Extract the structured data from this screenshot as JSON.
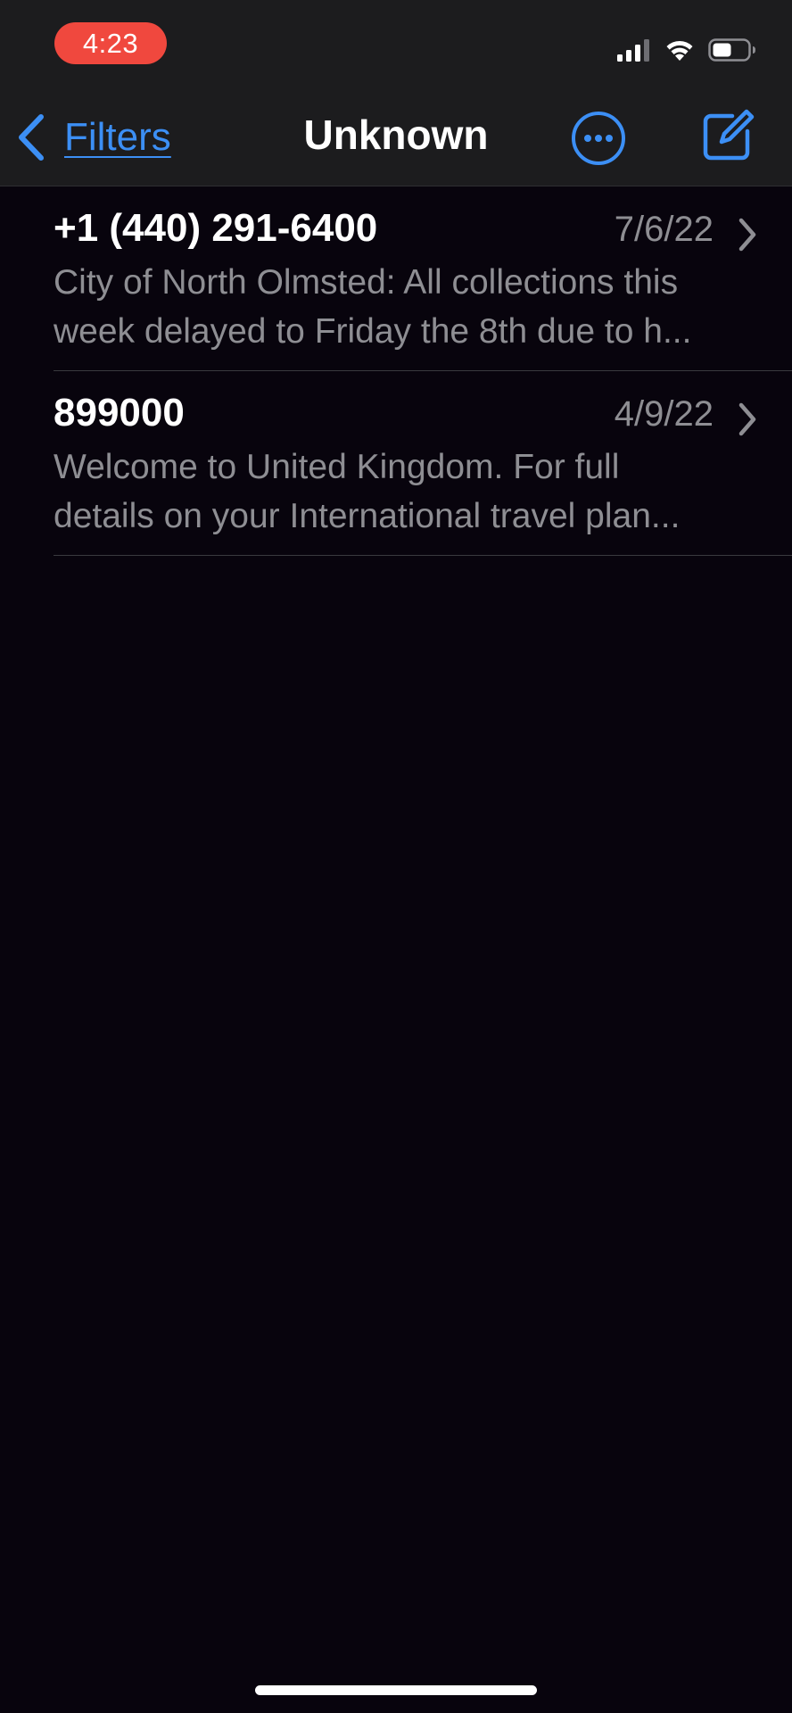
{
  "status_bar": {
    "time": "4:23",
    "time_pill_color": "#f0483e",
    "icons": [
      "cellular-signal-icon",
      "wifi-icon",
      "battery-icon"
    ]
  },
  "nav": {
    "back_label": "Filters",
    "title": "Unknown",
    "accent_color": "#3c8ff5",
    "icons": [
      "chevron-left-icon",
      "more-options-icon",
      "compose-icon"
    ]
  },
  "conversations": [
    {
      "sender": "+1 (440) 291-6400",
      "date": "7/6/22",
      "preview_line1": "City of North Olmsted: All collections this",
      "preview_line2": "week delayed to Friday the 8th due to h..."
    },
    {
      "sender": "899000",
      "date": "4/9/22",
      "preview_line1": "Welcome to United Kingdom. For full",
      "preview_line2": "details on your International travel plan..."
    }
  ]
}
